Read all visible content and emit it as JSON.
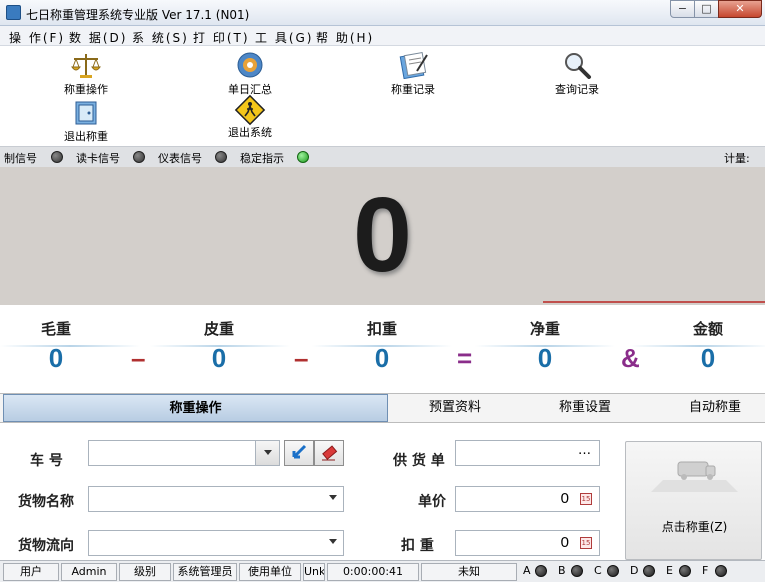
{
  "window": {
    "title": "七日称重管理系统专业版 Ver 17.1 (N01)",
    "min": "−",
    "max": "□",
    "close": "✕"
  },
  "menu": [
    "操 作(F)",
    "数 据(D)",
    "系 统(S)",
    "打 印(T)",
    "工 具(G)",
    "帮 助(H)"
  ],
  "toolbar": {
    "weigh_op": "称重操作",
    "daily_summary": "单日汇总",
    "weigh_records": "称重记录",
    "query_records": "查询记录",
    "exit_weigh": "退出称重",
    "exit_system": "退出系统"
  },
  "signals": {
    "control": "制信号",
    "card": "读卡信号",
    "meter": "仪表信号",
    "stable": "稳定指示",
    "metering": "计量:"
  },
  "display": {
    "value": "0"
  },
  "weights": {
    "gross_label": "毛重",
    "gross": "0",
    "tare_label": "皮重",
    "tare": "0",
    "deduct_label": "扣重",
    "deduct": "0",
    "net_label": "净重",
    "net": "0",
    "amount_label": "金额",
    "amount": "0",
    "op_minus1": "–",
    "op_minus2": "–",
    "op_equal": "=",
    "op_and": "&"
  },
  "tabs": [
    "称重操作",
    "预置资料",
    "称重设置",
    "自动称重"
  ],
  "form": {
    "plate_label": "车    号",
    "goods_label": "货物名称",
    "direction_label": "货物流向",
    "supplier_label": "供 货 单",
    "supplier_value": "…",
    "price_label": "单价",
    "price_value": "0",
    "deduct_label": "扣    重",
    "deduct_value": "0",
    "calc_glyph": "15",
    "weigh_button": "点击称重(Z)"
  },
  "status": {
    "user_label": "用户",
    "user": "Admin",
    "level_label": "级别",
    "level": "系统管理员",
    "unit_label": "使用单位",
    "unit": "Unk",
    "time": "0:00:00:41",
    "state": "未知",
    "lights": [
      "A",
      "B",
      "C",
      "D",
      "E",
      "F"
    ]
  },
  "colors": {
    "accent_blue": "#1a6ea8",
    "minus_red": "#b03030",
    "equal_purple": "#8a2d8a"
  }
}
